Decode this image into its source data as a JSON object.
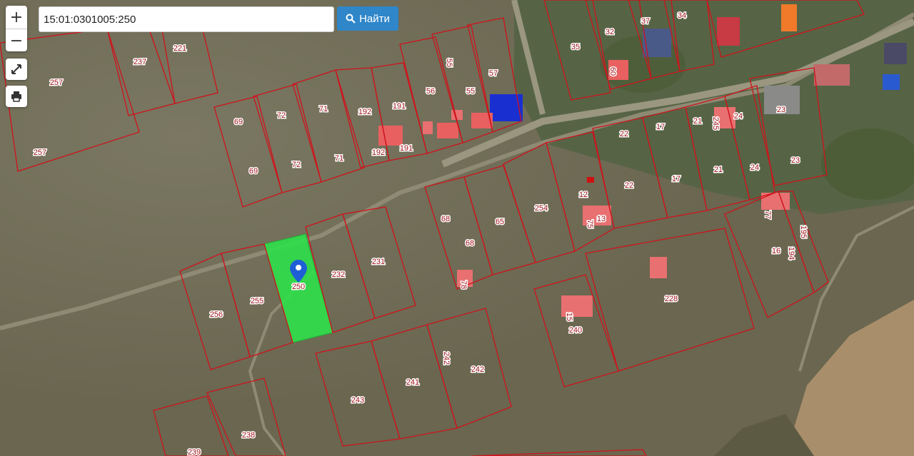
{
  "toolbar": {
    "zoom_in": "+",
    "zoom_out": "−",
    "search_value": "15:01:0301005:250",
    "search_button_label": "Найти"
  },
  "map": {
    "boundary_color": "#d0121b",
    "selected_color": "#2ee04a",
    "selected_parcel": "250",
    "parcel_labels": [
      "257",
      "257",
      "237",
      "221",
      "69",
      "69",
      "72",
      "72",
      "71",
      "71",
      "192",
      "191",
      "192",
      "191",
      "56",
      "55",
      "55",
      "57",
      "35",
      "32",
      "37",
      "34",
      "60",
      "22",
      "17",
      "21",
      "245",
      "24",
      "23",
      "23",
      "22",
      "17",
      "21",
      "24",
      "12",
      "13",
      "75",
      "254",
      "68",
      "68",
      "65",
      "78",
      "77",
      "195",
      "16",
      "194",
      "231",
      "232",
      "255",
      "256",
      "228",
      "240",
      "15",
      "243",
      "241",
      "242",
      "242",
      "238",
      "239",
      "250"
    ]
  }
}
